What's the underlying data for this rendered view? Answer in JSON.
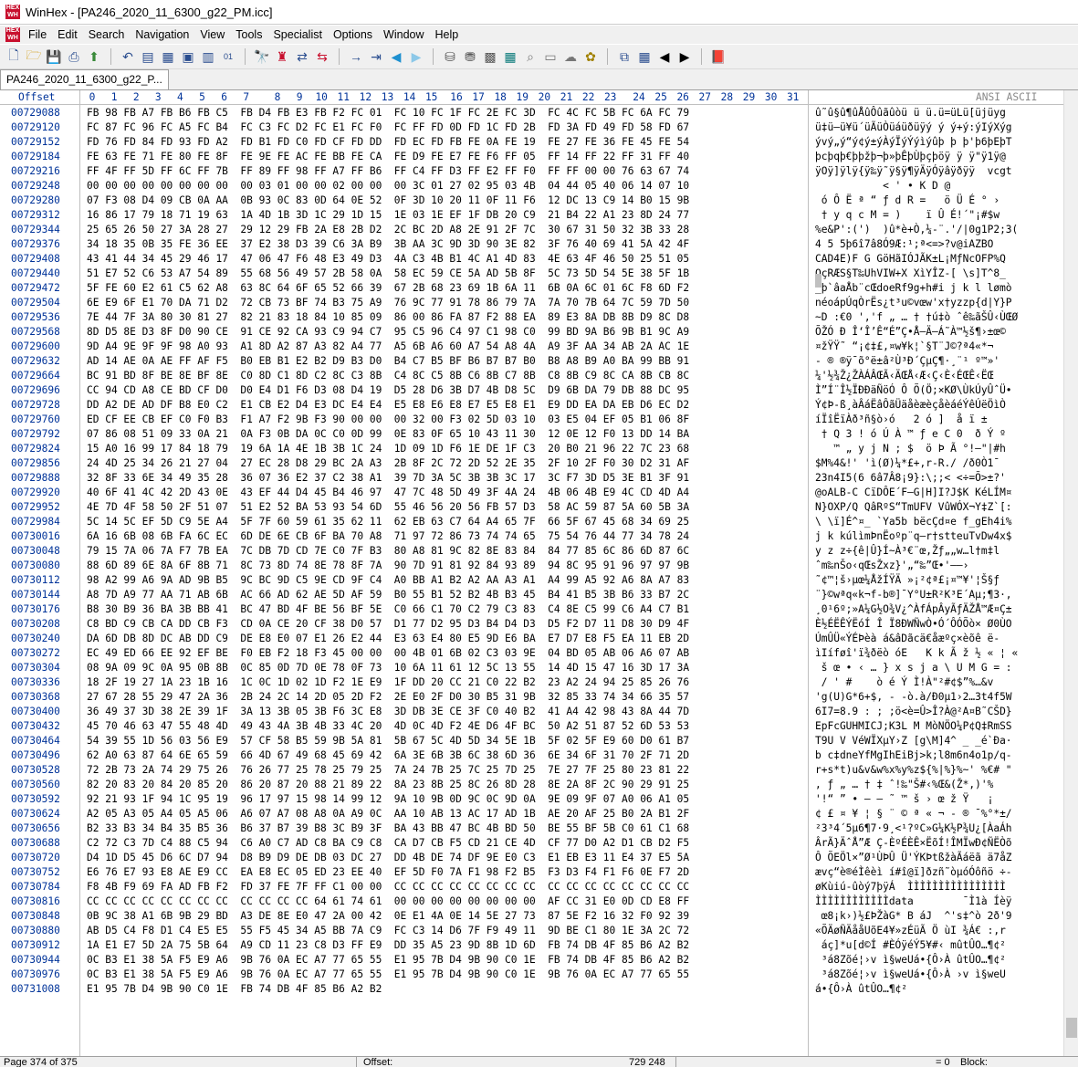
{
  "window": {
    "title": "WinHex - [PA246_2020_11_6300_g22_PM.icc]"
  },
  "menu": [
    "File",
    "Edit",
    "Search",
    "Navigation",
    "View",
    "Tools",
    "Specialist",
    "Options",
    "Window",
    "Help"
  ],
  "toolbar_icons": [
    "new-file-icon",
    "open-file-icon",
    "save-icon",
    "print-icon",
    "properties-icon",
    "undo-icon",
    "cut-icon",
    "copy-block-icon",
    "copy-all-icon",
    "paste-icon",
    "write-icon",
    "find-text-icon",
    "find-hex-icon",
    "replace-text-icon",
    "replace-hex-icon",
    "goto-offset-icon",
    "goto-sector-icon",
    "back-icon",
    "forward-icon",
    "open-disk-icon",
    "disk-tools-icon",
    "ram-icon",
    "calculator-icon",
    "zoom-icon",
    "hash-icon",
    "cloud-icon",
    "lucky-icon",
    "compare-icon",
    "table-icon",
    "prev-icon",
    "next-icon",
    "book-icon"
  ],
  "tab": {
    "label": "PA246_2020_11_6300_g22_P..."
  },
  "hex_view": {
    "offset_label": "Offset",
    "columns": [
      "0",
      "1",
      "2",
      "3",
      "4",
      "5",
      "6",
      "7",
      "8",
      "9",
      "10",
      "11",
      "12",
      "13",
      "14",
      "15",
      "16",
      "17",
      "18",
      "19",
      "20",
      "21",
      "22",
      "23",
      "24",
      "25",
      "26",
      "27",
      "28",
      "29",
      "30",
      "31"
    ],
    "ansi_label": "ANSI ASCII",
    "rows": [
      {
        "offset": "00729088",
        "hex": "FB 98 FB A7 FB B6 FB C5  FB D4 FB E3 FB F2 FC 01  FC 10 FC 1F FC 2E FC 3D  FC 4C FC 5B FC 6A FC 79",
        "ascii": "û˜û§û¶ûÅûÔûãûòü ü ü.ü=üLü[üjüyg"
      },
      {
        "offset": "00729120",
        "hex": "FC 87 FC 96 FC A5 FC B4  FC C3 FC D2 FC E1 FC F0  FC FF FD 0D FD 1C FD 2B  FD 3A FD 49 FD 58 FD 67",
        "ascii": "ü‡ü–ü¥ü´üÃüÒüáüðüÿý ý ý+ý:ýIýXýg"
      },
      {
        "offset": "00729152",
        "hex": "FD 76 FD 84 FD 93 FD A2  FD B1 FD C0 FD CF FD DD  FD EC FD FB FE 0A FE 19  FE 27 FE 36 FE 45 FE 54",
        "ascii": "ývý„ý“ý¢ý±ýÀýÏýÝýìýûþ þ þ'þ6þEþT"
      },
      {
        "offset": "00729184",
        "hex": "FE 63 FE 71 FE 80 FE 8F  FE 9E FE AC FE BB FE CA  FE D9 FE E7 FE F6 FF 05  FF 14 FF 22 FF 31 FF 40",
        "ascii": "þcþqþ€þþžþ¬þ»þÊþÙþçþöÿ ÿ ÿ\"ÿ1ÿ@"
      },
      {
        "offset": "00729216",
        "hex": "FF 4F FF 5D FF 6C FF 7B  FF 89 FF 98 FF A7 FF B6  FF C4 FF D3 FF E2 FF F0  FF FF 00 00 76 63 67 74",
        "ascii": "ÿOÿ]ÿlÿ{ÿ‰ÿ˜ÿ§ÿ¶ÿÄÿÓÿâÿðÿÿ  vcgt"
      },
      {
        "offset": "00729248",
        "hex": "00 00 00 00 00 00 00 00  00 03 01 00 00 02 00 00  00 3C 01 27 02 95 03 4B  04 44 05 40 06 14 07 10",
        "ascii": "           < ' • K D @"
      },
      {
        "offset": "00729280",
        "hex": "07 F3 08 D4 09 CB 0A AA  0B 93 0C 83 0D 64 0E 52  0F 3D 10 20 11 0F 11 F6  12 DC 13 C9 14 B0 15 9B",
        "ascii": " ó Ô Ë ª “ ƒ d R =   ö Ü É ° ›"
      },
      {
        "offset": "00729312",
        "hex": "16 86 17 79 18 71 19 63  1A 4D 1B 3D 1C 29 1D 15  1E 03 1E EF 1F DB 20 C9  21 B4 22 A1 23 8D 24 77",
        "ascii": " † y q c M = )    ï Û É!´\"¡#$w"
      },
      {
        "offset": "00729344",
        "hex": "25 65 26 50 27 3A 28 27  29 12 29 FB 2A E8 2B D2  2C BC 2D A8 2E 91 2F 7C  30 67 31 50 32 3B 33 28",
        "ascii": "%e&P':(')  )û*è+Ò,¼-¨.'/|0g1P2;3("
      },
      {
        "offset": "00729376",
        "hex": "34 18 35 0B 35 FE 36 EE  37 E2 38 D3 39 C6 3A B9  3B AA 3C 9D 3D 90 3E 82  3F 76 40 69 41 5A 42 4F",
        "ascii": "4 5 5þ6î7â8Ó9Æ:¹;ª<=>?v@iAZBO"
      },
      {
        "offset": "00729408",
        "hex": "43 41 44 34 45 29 46 17  47 06 47 F6 48 E3 49 D3  4A C3 4B B1 4C A1 4D 83  4E 63 4F 46 50 25 51 05",
        "ascii": "CAD4E)F G GöHãIÓJÃK±L¡MƒNcOFP%Q"
      },
      {
        "offset": "00729440",
        "hex": "51 E7 52 C6 53 A7 54 89  55 68 56 49 57 2B 58 0A  58 EC 59 CE 5A AD 5B 8F  5C 73 5D 54 5E 38 5F 1B",
        "ascii": "QçRÆS§T‰UhVIW+X XìYÎZ-[ \\s]T^8_"
      },
      {
        "offset": "00729472",
        "hex": "5F FE 60 E2 61 C5 62 A8  63 8C 64 6F 65 52 66 39  67 2B 68 23 69 1B 6A 11  6B 0A 6C 01 6C F8 6D F2",
        "ascii": "_þ`âaÅb¨cŒdoeRf9g+h#i j k l lømò"
      },
      {
        "offset": "00729504",
        "hex": "6E E9 6F E1 70 DA 71 D2  72 CB 73 BF 74 B3 75 A9  76 9C 77 91 78 86 79 7A  7A 70 7B 64 7C 59 7D 50",
        "ascii": "néoápÚqÒrËs¿t³u©vœw'x†yzzp{d|Y}P"
      },
      {
        "offset": "00729536",
        "hex": "7E 44 7F 3A 80 30 81 27  82 21 83 18 84 10 85 09  86 00 86 FA 87 F2 88 EA  89 E3 8A DB 8B D9 8C D8",
        "ascii": "~D :€0 ','f „ … † †ú‡ò ˆê‰ãŠÛ‹ÙŒØ"
      },
      {
        "offset": "00729568",
        "hex": "8D D5 8E D3 8F D0 90 CE  91 CE 92 CA 93 C9 94 C7  95 C5 96 C4 97 C1 98 C0  99 BD 9A B6 9B B1 9C A9",
        "ascii": "ÕŽÓ Ð ÎʻÎ’Ê“É”Ç•Å–Ä—Á˜À™½š¶›±œ©"
      },
      {
        "offset": "00729600",
        "hex": "9D A4 9E 9F 9F 98 A0 93  A1 8D A2 87 A3 82 A4 77  A5 6B A6 60 A7 54 A8 4A  A9 3F AA 34 AB 2A AC 1E",
        "ascii": "¤žŸŸ˜ “¡¢‡£‚¤w¥k¦`§T¨J©?ª4«*¬"
      },
      {
        "offset": "00729632",
        "hex": "AD 14 AE 0A AE FF AF F5  B0 EB B1 E2 B2 D9 B3 D0  B4 C7 B5 BF B6 B7 B7 B0  B8 A8 B9 A0 BA 99 BB 91",
        "ascii": "- ® ®ÿ¯õ°ë±â²Ù³Ð´ÇµÇ¶·¸¨¹ º™»'"
      },
      {
        "offset": "00729664",
        "hex": "BC 91 BD 8F BE 8E BF 8E  C0 8D C1 8D C2 8C C3 8B  C4 8C C5 8B C6 8B C7 8B  C8 8B C9 8C CA 8B CB 8C",
        "ascii": "¼'½¾Ž¿ŽÀÁÂŒÃ‹ÄŒÅ‹Æ‹Ç‹È‹ÉŒÊ‹ËŒ"
      },
      {
        "offset": "00729696",
        "hex": "CC 94 CD A8 CE BD CF D0  D0 E4 D1 F6 D3 08 D4 19  D5 28 D6 3B D7 4B D8 5C  D9 6B DA 79 DB 88 DC 95",
        "ascii": "Ì”Í¨Î½ÏÐÐäÑöÓ Ô Õ(Ö;×KØ\\ÙkÚyÛˆÜ•"
      },
      {
        "offset": "00729728",
        "hex": "DD A2 DE AD DF B8 E0 C2  E1 CB E2 D4 E3 DC E4 E4  E5 E8 E6 E8 E7 E5 E8 E1  E9 DD EA DA EB D6 EC D2",
        "ascii": "Ý¢Þ-ß¸àÂáËâÔãÜäåèæèçåèáéÝêÚëÖìÒ"
      },
      {
        "offset": "00729760",
        "hex": "ED CF EE CB EF C0 F0 B3  F1 A7 F2 9B F3 90 00 00  00 32 00 F3 02 5D 03 10  03 E5 04 EF 05 B1 06 8F",
        "ascii": "íÏîËïÀð³ñ§ò›ó   2 ó ]  å ï ± "
      },
      {
        "offset": "00729792",
        "hex": "07 86 08 51 09 33 0A 21  0A F3 0B DA 0C C0 0D 99  0E 83 0F 65 10 43 11 30  12 0E 12 F0 13 DD 14 BA",
        "ascii": " † Q 3 ! ó Ú À ™ ƒ e C 0  ð Ý º"
      },
      {
        "offset": "00729824",
        "hex": "15 A0 16 99 17 84 18 79  19 6A 1A 4E 1B 3B 1C 24  1D 09 1D F6 1E DE 1F C3  20 B0 21 96 22 7C 23 68",
        "ascii": "   ™ „ y j N ; $  ö Þ Ã °!–\"|#h"
      },
      {
        "offset": "00729856",
        "hex": "24 4D 25 34 26 21 27 04  27 EC 28 D8 29 BC 2A A3  2B 8F 2C 72 2D 52 2E 35  2F 10 2F F0 30 D2 31 AF",
        "ascii": "$M%4&!' 'ì(Ø)¼*£+,r-R./ /ð0Ò1¯"
      },
      {
        "offset": "00729888",
        "hex": "32 8F 33 6E 34 49 35 28  36 07 36 E2 37 C2 38 A1  39 7D 3A 5C 3B 3B 3C 17  3C F7 3D D5 3E B1 3F 91",
        "ascii": "23n4I5(6 6â7Â8¡9}:\\;;< <÷=Õ>±?'"
      },
      {
        "offset": "00729920",
        "hex": "40 6F 41 4C 42 2D 43 0E  43 EF 44 D4 45 B4 46 97  47 7C 48 5D 49 3F 4A 24  4B 06 4B E9 4C CD 4D A4",
        "ascii": "@oALB-C CïDÔE´F—G|H]I?J$K KéLÍM¤"
      },
      {
        "offset": "00729952",
        "hex": "4E 7D 4F 58 50 2F 51 07  51 E2 52 BA 53 93 54 6D  55 46 56 20 56 FB 57 D3  58 AC 59 87 5A 60 5B 3A",
        "ascii": "N}OXP/Q QâRºS“TmUFV VûWÓX¬Y‡Z`[:"
      },
      {
        "offset": "00729984",
        "hex": "5C 14 5C EF 5D C9 5E A4  5F 7F 60 59 61 35 62 11  62 EB 63 C7 64 A4 65 7F  66 5F 67 45 68 34 69 25",
        "ascii": "\\ \\ï]É^¤_ `Ya5b bëcÇd¤e f_gEh4i%"
      },
      {
        "offset": "00730016",
        "hex": "6A 16 6B 08 6B FA 6C EC  6D DE 6E CB 6F BA 70 A8  71 97 72 86 73 74 74 65  75 54 76 44 77 34 78 24",
        "ascii": "j k kúlìmÞnËoºp¨q—r†stteuTvDw4x$"
      },
      {
        "offset": "00730048",
        "hex": "79 15 7A 06 7A F7 7B EA  7C DB 7D CD 7E C0 7F B3  80 A8 81 9C 82 8E 83 84  84 77 85 6C 86 6D 87 6C",
        "ascii": "y z z÷{ê|Û}Í~À³€¨œ‚Žƒ„„w…l†m‡l"
      },
      {
        "offset": "00730080",
        "hex": "88 6D 89 6E 8A 6F 8B 71  8C 73 8D 74 8E 78 8F 7A  90 7D 91 81 92 84 93 89  94 8C 95 91 96 97 97 9B",
        "ascii": "ˆm‰nŠo‹qŒsŽxz}'„“‰”Œ•'–—›"
      },
      {
        "offset": "00730112",
        "hex": "98 A2 99 A6 9A AD 9B B5  9C BC 9D C5 9E CD 9F C4  A0 BB A1 B2 A2 AA A3 A1  A4 99 A5 92 A6 8A A7 83",
        "ascii": "˜¢™¦š›µœ¼ÅžÍŸÄ »¡²¢ª£¡¤™¥'¦Š§ƒ"
      },
      {
        "offset": "00730144",
        "hex": "A8 7D A9 77 AA 71 AB 6B  AC 66 AD 62 AE 5D AF 59  B0 55 B1 52 B2 4B B3 45  B4 41 B5 3B B6 33 B7 2C",
        "ascii": "¨}©wªq«k¬f-b®]¯Y°U±R²K³E´Aµ;¶3·,"
      },
      {
        "offset": "00730176",
        "hex": "B8 30 B9 36 BA 3B BB 41  BC 47 BD 4F BE 56 BF 5E  C0 66 C1 70 C2 79 C3 83  C4 8E C5 99 C6 A4 C7 B1",
        "ascii": "¸0¹6º;»A¼G½O¾V¿^ÀfÁpÂyÃƒÄŽÅ™Æ¤Ç±"
      },
      {
        "offset": "00730208",
        "hex": "C8 BD C9 CB CA DD CB F3  CD 0A CE 20 CF 38 D0 57  D1 77 D2 95 D3 B4 D4 D3  D5 F2 D7 11 D8 30 D9 4F",
        "ascii": "È½ÉËÊÝËóÍ Î Ï8ÐWÑwÒ•Ó´ÔÓÕò× Ø0ÙO"
      },
      {
        "offset": "00730240",
        "hex": "DA 6D DB 8D DC AB DD C9  DE E8 E0 07 E1 26 E2 44  E3 63 E4 80 E5 9D E6 BA  E7 D7 E8 F5 EA 11 EB 2D",
        "ascii": "ÚmÛÜ«ÝÉÞèà á&âDãcä€åæºç×èõê ë-"
      },
      {
        "offset": "00730272",
        "hex": "EC 49 ED 66 EE 92 EF BE  F0 EB F2 18 F3 45 00 00  00 4B 01 6B 02 C3 03 9E  04 BD 05 AB 06 A6 07 AB",
        "ascii": "ìIíføî'ï¾ðëò óE   K k Ã ž ½ « ¦ «"
      },
      {
        "offset": "00730304",
        "hex": "08 9A 09 9C 0A 95 0B 8B  0C 85 0D 7D 0E 78 0F 73  10 6A 11 61 12 5C 13 55  14 4D 15 47 16 3D 17 3A",
        "ascii": " š œ • ‹ … } x s j a \\ U M G = :"
      },
      {
        "offset": "00730336",
        "hex": "18 2F 19 27 1A 23 1B 16  1C 0C 1D 02 1D F2 1E E9  1F DD 20 CC 21 C0 22 B2  23 A2 24 94 25 85 26 76",
        "ascii": " / ' #    ò é Ý Ì!À\"²#¢$”%…&v"
      },
      {
        "offset": "00730368",
        "hex": "27 67 28 55 29 47 2A 36  2B 24 2C 14 2D 05 2D F2  2E E0 2F D0 30 B5 31 9B  32 85 33 74 34 66 35 57",
        "ascii": "'g(U)G*6+$, - -ò.à/Ð0µ1›2…3t4f5W"
      },
      {
        "offset": "00730400",
        "hex": "36 49 37 3D 38 2E 39 1F  3A 13 3B 05 3B F6 3C E8  3D DB 3E CE 3F C0 40 B2  41 A4 42 98 43 8A 44 7D",
        "ascii": "6I7=8.9 : ; ;ö<è=Û>Î?À@²A¤B˜CŠD}"
      },
      {
        "offset": "00730432",
        "hex": "45 70 46 63 47 55 48 4D  49 43 4A 3B 4B 33 4C 20  4D 0C 4D F2 4E D6 4F BC  50 A2 51 87 52 6D 53 53",
        "ascii": "EpFcGUHMICJ;K3L M MòNÖO¼P¢Q‡RmSS"
      },
      {
        "offset": "00730464",
        "hex": "54 39 55 1D 56 03 56 E9  57 CF 58 B5 59 9B 5A 81  5B 67 5C 4D 5D 34 5E 1B  5F 02 5F E9 60 D0 61 B7",
        "ascii": "T9U V VéWÏXµY›Z [g\\M]4^ _ _é`Ða·"
      },
      {
        "offset": "00730496",
        "hex": "62 A0 63 87 64 6E 65 59  66 4D 67 49 68 45 69 42  6A 3E 6B 3B 6C 38 6D 36  6E 34 6F 31 70 2F 71 2D",
        "ascii": "b c‡dneYfMgIhEiBj>k;l8m6n4o1p/q-"
      },
      {
        "offset": "00730528",
        "hex": "72 2B 73 2A 74 29 75 26  76 26 77 25 78 25 79 25  7A 24 7B 25 7C 25 7D 25  7E 27 7F 25 80 23 81 22",
        "ascii": "r+s*t)u&v&w%x%y%z${%|%}%~' %€# \""
      },
      {
        "offset": "00730560",
        "hex": "82 20 83 20 84 20 85 20  86 20 87 20 88 21 89 22  8A 23 8B 25 8C 26 8D 28  8E 2A 8F 2C 90 29 91 25",
        "ascii": "‚ ƒ „ … † ‡ ˆ!‰\"Š#‹%Œ&(Ž*,)'%"
      },
      {
        "offset": "00730592",
        "hex": "92 21 93 1F 94 1C 95 19  96 17 97 15 98 14 99 12  9A 10 9B 0D 9C 0C 9D 0A  9E 09 9F 07 A0 06 A1 05",
        "ascii": "'!“ ” • – — ˜ ™ š › œ ž Ÿ   ¡"
      },
      {
        "offset": "00730624",
        "hex": "A2 05 A3 05 A4 05 A5 06  A6 07 A7 08 A8 0A A9 0C  AA 10 AB 13 AC 17 AD 1B  AE 20 AF 25 B0 2A B1 2F",
        "ascii": "¢ £ ¤ ¥ ¦ § ¨ © ª « ¬ - ® ¯%°*±/"
      },
      {
        "offset": "00730656",
        "hex": "B2 33 B3 34 B4 35 B5 36  B6 37 B7 39 B8 3C B9 3F  BA 43 BB 47 BC 4B BD 50  BE 55 BF 5B C0 61 C1 68",
        "ascii": "²3³4´5µ6¶7·9¸<¹?ºC»G¼K½P¾U¿[ÀaÁh"
      },
      {
        "offset": "00730688",
        "hex": "C2 72 C3 7D C4 88 C5 94  C6 A0 C7 AD C8 BA C9 C8  CA D7 CB F5 CD 21 CE 4D  CF 77 D0 A2 D1 CB D2 F5",
        "ascii": "ÂrÃ}ÄˆÅ”Æ Ç-ÈºÉÈÊ×ËõÍ!ÎMÏwÐ¢ÑËÒõ"
      },
      {
        "offset": "00730720",
        "hex": "D4 1D D5 45 D6 6C D7 94  D8 B9 D9 DE DB 03 DC 27  DD 4B DE 74 DF 9E E0 C3  E1 EB E3 11 E4 37 E5 5A",
        "ascii": "Ô ÕEÖl×”Ø¹ÙÞÛ Ü'ÝKÞtßžàÃáëã ä7åZ"
      },
      {
        "offset": "00730752",
        "hex": "E6 76 E7 93 E8 AE E9 CC  EA E8 EC 05 ED 23 EE 40  EF 5D F0 7A F1 98 F2 B5  F3 D3 F4 F1 F6 0E F7 2D",
        "ascii": "ævç“è®éÌêèì í#î@ï]ðzñ˜òµóÓôñö ÷-"
      },
      {
        "offset": "00730784",
        "hex": "F8 4B F9 69 FA AD FB F2  FD 37 FE 7F FF C1 00 00  CC CC CC CC CC CC CC CC  CC CC CC CC CC CC CC CC",
        "ascii": "øKùiú-ûòý7þÿÁ  ÌÌÌÌÌÌÌÌÌÌÌÌÌÌÌÌ"
      },
      {
        "offset": "00730816",
        "hex": "CC CC CC CC CC CC CC CC  CC CC CC CC 64 61 74 61  00 00 00 00 00 00 00 00  AF CC 31 E0 0D CD E8 FF",
        "ascii": "ÌÌÌÌÌÌÌÌÌÌÌÌdata        ¯Ì1à Íèÿ"
      },
      {
        "offset": "00730848",
        "hex": "0B 9C 38 A1 6B 9B 29 BD  A3 DE 8E E0 47 2A 00 42  0E E1 4A 0E 14 5E 27 73  87 5E F2 16 32 F0 92 39",
        "ascii": " œ8¡k›)½£ÞŽàG* B áJ  ^'s‡^ò 2ð'9"
      },
      {
        "offset": "00730880",
        "hex": "AB D5 C4 F8 D1 C4 E5 E5  55 F5 45 34 A5 BB 7A C9  FC C3 14 D6 7F F9 49 11  9D BE C1 80 1E 3A 2C 72",
        "ascii": "«ÕÄøÑÄååUõE4¥»zÉüÃ Ö ùI ¾Á€ :,r"
      },
      {
        "offset": "00730912",
        "hex": "1A E1 E7 5D 2A 75 5B 64  A9 CD 11 23 C8 D3 FF E9  DD 35 A5 23 9D 8B 1D 6D  FB 74 DB 4F 85 B6 A2 B2",
        "ascii": " áç]*u[d©Í #ÈÓÿéÝ5¥#‹ mûtÛO…¶¢²"
      },
      {
        "offset": "00730944",
        "hex": "0C B3 E1 38 5A F5 E9 A6  9B 76 0A EC A7 77 65 55  E1 95 7B D4 9B 90 C0 1E  FB 74 DB 4F 85 B6 A2 B2",
        "ascii": " ³á8Zõé¦›v ì§weUá•{Ô›À ûtÛO…¶¢²"
      },
      {
        "offset": "00730976",
        "hex": "0C B3 E1 38 5A F5 E9 A6  9B 76 0A EC A7 77 65 55  E1 95 7B D4 9B 90 C0 1E  9B 76 0A EC A7 77 65 55",
        "ascii": " ³á8Zõé¦›v ì§weUá•{Ô›À ›v ì§weU"
      },
      {
        "offset": "00731008",
        "hex": "E1 95 7B D4 9B 90 C0 1E  FB 74 DB 4F 85 B6 A2 B2",
        "ascii": "á•{Ô›À ûtÛO…¶¢²"
      }
    ]
  },
  "status": {
    "page": "Page 374 of 375",
    "offset_label": "Offset:",
    "offset_value": "729 248",
    "selection": "= 0",
    "block_label": "Block:"
  }
}
